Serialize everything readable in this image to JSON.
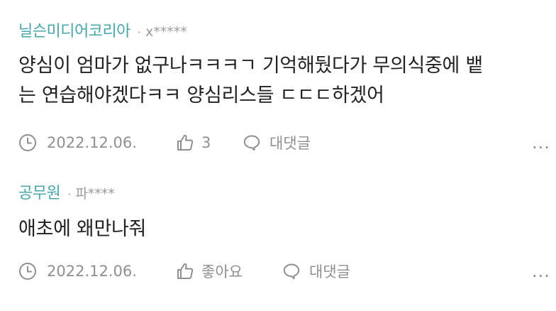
{
  "comments": [
    {
      "author": "닐슨미디어코리아",
      "separator": "·",
      "masked_id": "x*****",
      "body_lines": [
        "양심이 엄마가 없구나ㅋㅋㅋㄱ 기억해뒀다가 무의식중에 뱉",
        "는 연습해야겠다ㅋㅋ 양심리스들 ㄷㄷㄷ하겠어"
      ],
      "date": "2022.12.06.",
      "like_text": "3",
      "reply_label": "대댓글",
      "more": "..."
    },
    {
      "author": "공무원",
      "separator": "·",
      "masked_id": "파****",
      "body_lines": [
        "애초에 왜만나줘"
      ],
      "date": "2022.12.06.",
      "like_text": "좋아요",
      "reply_label": "대댓글",
      "more": "..."
    }
  ],
  "icons": {
    "date": "clock-icon",
    "like": "thumbs-up-icon",
    "reply": "speech-bubble-icon",
    "more": "more-options-icon"
  },
  "colors": {
    "author": "#49a6a8",
    "meta": "#8f8f8f",
    "body": "#222222",
    "background": "#ffffff"
  }
}
